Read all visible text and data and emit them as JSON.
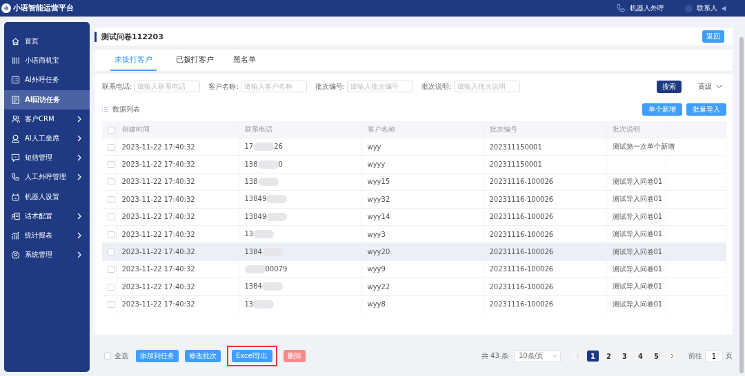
{
  "app": {
    "title": "小语智能运营平台",
    "call_label": "机器人外呼",
    "user_label": "联系人"
  },
  "sidebar": {
    "items": [
      {
        "label": "首页",
        "selected": false,
        "expandable": false
      },
      {
        "label": "小语商机宝",
        "selected": false,
        "expandable": false
      },
      {
        "label": "AI外呼任务",
        "selected": false,
        "expandable": false
      },
      {
        "label": "AI回访任务",
        "selected": true,
        "expandable": false
      },
      {
        "label": "客户CRM",
        "selected": false,
        "expandable": true
      },
      {
        "label": "AI人工坐席",
        "selected": false,
        "expandable": true
      },
      {
        "label": "短信管理",
        "selected": false,
        "expandable": true
      },
      {
        "label": "人工外呼管理",
        "selected": false,
        "expandable": true
      },
      {
        "label": "机器人设置",
        "selected": false,
        "expandable": false
      },
      {
        "label": "话术配置",
        "selected": false,
        "expandable": true
      },
      {
        "label": "统计报表",
        "selected": false,
        "expandable": true
      },
      {
        "label": "系统管理",
        "selected": false,
        "expandable": true
      }
    ]
  },
  "page": {
    "title": "测试问卷112203",
    "back_button": "返回"
  },
  "tabs": [
    {
      "label": "未拨打客户",
      "selected": true
    },
    {
      "label": "已拨打客户",
      "selected": false
    },
    {
      "label": "黑名单",
      "selected": false
    }
  ],
  "filters": [
    {
      "label": "联系电话:",
      "placeholder": "请输入联系电话"
    },
    {
      "label": "客户名称:",
      "placeholder": "请输入客户名称"
    },
    {
      "label": "批次编号:",
      "placeholder": "请输入批次编号"
    },
    {
      "label": "批次说明:",
      "placeholder": "请输入批次说明"
    }
  ],
  "search_button": "搜索",
  "advanced_label": "高级",
  "list_title": "数据列表",
  "list_buttons": [
    "单个新增",
    "批量导入"
  ],
  "table": {
    "header_checked": false,
    "columns": [
      "创建时间",
      "联系电话",
      "客户名称",
      "批次编号",
      "批次说明"
    ],
    "rows": [
      {
        "checked": false,
        "highlighted": false,
        "created": "2023-11-22 17:40:32",
        "phone_start": "17",
        "phone_end": "26",
        "name": "wyy",
        "batch": "202311150001",
        "note": "测试第一次单个新增"
      },
      {
        "checked": false,
        "highlighted": false,
        "created": "2023-11-22 17:40:32",
        "phone_start": "138",
        "phone_end": "0",
        "name": "wyyy",
        "batch": "202311150001"
      },
      {
        "checked": false,
        "highlighted": false,
        "created": "2023-11-22 17:40:32",
        "phone_start": "138",
        "name": "wyy15",
        "batch": "20231116-100026",
        "note": "测试导入问卷01"
      },
      {
        "checked": false,
        "highlighted": false,
        "created": "2023-11-22 17:40:32",
        "phone_start": "13849",
        "name": "wyy32",
        "batch": "20231116-100026",
        "note": "测试导入问卷01"
      },
      {
        "checked": false,
        "highlighted": false,
        "created": "2023-11-22 17:40:32",
        "phone_start": "13849",
        "name": "wyy14",
        "batch": "20231116-100026",
        "note": "测试导入问卷01"
      },
      {
        "checked": false,
        "highlighted": false,
        "created": "2023-11-22 17:40:32",
        "phone_start": "13",
        "name": "wyy3",
        "batch": "20231116-100026",
        "note": "测试导入问卷01"
      },
      {
        "checked": false,
        "highlighted": true,
        "created": "2023-11-22 17:40:32",
        "phone_start": "1384",
        "name": "wyy20",
        "batch": "20231116-100026",
        "note": "测试导入问卷01"
      },
      {
        "checked": false,
        "highlighted": false,
        "created": "2023-11-22 17:40:32",
        "phone_end": "00079",
        "name": "wyy9",
        "batch": "20231116-100026",
        "note": "测试导入问卷01"
      },
      {
        "checked": false,
        "highlighted": false,
        "created": "2023-11-22 17:40:32",
        "phone_start": "1384",
        "name": "wyy22",
        "batch": "20231116-100026",
        "note": "测试导入问卷01"
      },
      {
        "checked": false,
        "highlighted": false,
        "created": "2023-11-22 17:40:32",
        "phone_start": "13",
        "name": "wyy8",
        "batch": "20231116-100026",
        "note": "测试导入问卷01"
      }
    ]
  },
  "footer": {
    "select_all": {
      "label": "全选",
      "checked": false
    },
    "buttons": [
      {
        "label": "添加到任务",
        "kind": "primary",
        "annotated": false
      },
      {
        "label": "修改批次",
        "kind": "primary",
        "annotated": false
      },
      {
        "label": "Excel导出",
        "kind": "primary",
        "annotated": true
      },
      {
        "label": "删除",
        "kind": "danger",
        "annotated": false
      }
    ]
  },
  "pagination": {
    "total": "共 43 条",
    "page_size": "10条/页",
    "pages": [
      {
        "label": "1",
        "selected": true
      },
      {
        "label": "2",
        "selected": false
      },
      {
        "label": "3",
        "selected": false
      },
      {
        "label": "4",
        "selected": false
      },
      {
        "label": "5",
        "selected": false
      }
    ],
    "goto_label": "前往",
    "goto_value": "1",
    "page_unit": "页"
  }
}
